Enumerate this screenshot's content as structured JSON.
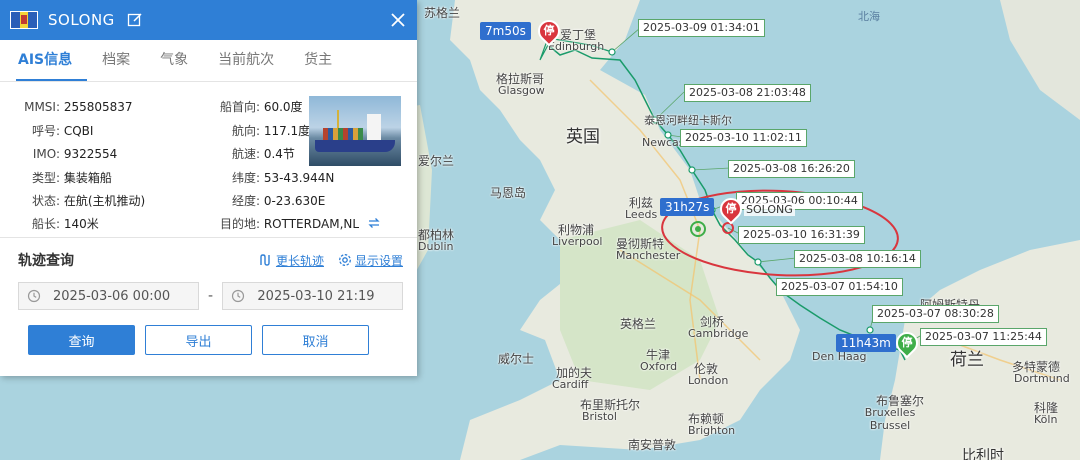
{
  "map": {
    "countries": {
      "uk": "英国",
      "nl": "荷兰",
      "be": "比利时"
    },
    "seas": {
      "north_sea": "北海"
    },
    "cities": [
      {
        "cn": "爱丁堡",
        "en": "Edinburgh"
      },
      {
        "cn": "格拉斯哥",
        "en": "Glasgow"
      },
      {
        "cn": "利兹",
        "en": "Leeds"
      },
      {
        "cn": "利物浦",
        "en": "Liverpool"
      },
      {
        "cn": "曼彻斯特",
        "en": "Manchester"
      },
      {
        "cn": "剑桥",
        "en": "Cambridge"
      },
      {
        "cn": "伦敦",
        "en": "London"
      },
      {
        "cn": "牛津",
        "en": "Oxford"
      },
      {
        "cn": "加的夫",
        "en": "Cardiff"
      },
      {
        "cn": "布里斯托尔",
        "en": "Bristol"
      },
      {
        "cn": "布赖顿",
        "en": "Brighton"
      },
      {
        "cn": "南安普敦",
        "en": "Southampton"
      },
      {
        "cn": "多特蒙德",
        "en": "Dortmund"
      },
      {
        "cn": "科隆",
        "en": "Köln"
      },
      {
        "cn": "布鲁塞尔",
        "en": "Bruxelles Brussel"
      },
      {
        "cn": "都柏林",
        "en": "Dublin"
      },
      {
        "cn": "阿姆斯特丹",
        "en": ""
      },
      {
        "cn": "泰恩河畔纽卡斯尔",
        "en": "Newcastle"
      },
      {
        "cn": "马恩岛",
        "en": ""
      },
      {
        "cn": "英格兰",
        "en": ""
      },
      {
        "cn": "威尔士",
        "en": ""
      },
      {
        "cn": "爱尔兰",
        "en": ""
      },
      {
        "cn": "苏格兰",
        "en": ""
      }
    ],
    "den_haag": "Den Haag",
    "timestamps": [
      "2025-03-09 01:34:01",
      "2025-03-08 21:03:48",
      "2025-03-10 11:02:11",
      "2025-03-08 16:26:20",
      "2025-03-06 00:10:44",
      "2025-03-10 16:31:39",
      "2025-03-08 10:16:14",
      "2025-03-07 01:54:10",
      "2025-03-07 08:30:28",
      "2025-03-07 11:25:44"
    ],
    "durations": [
      "7m50s",
      "31h27s",
      "11h43m"
    ],
    "stop_label": "停",
    "ship_name_label": "SOLONG",
    "colors": {
      "track": "#1a9b6a",
      "highlight_ring": "#d9363e",
      "land": "#e8eadf",
      "water": "#aad3df"
    }
  },
  "panel": {
    "ship_name": "SOLONG",
    "tabs": [
      "AIS信息",
      "档案",
      "气象",
      "当前航次",
      "货主"
    ],
    "active_tab": 0,
    "info_left": [
      {
        "label": "MMSI:",
        "value": "255805837"
      },
      {
        "label": "呼号:",
        "value": "CQBI"
      },
      {
        "label": "IMO:",
        "value": "9322554"
      },
      {
        "label": "类型:",
        "value": "集装箱船"
      },
      {
        "label": "状态:",
        "value": "在航(主机推动)"
      },
      {
        "label": "船长:",
        "value": "140米"
      }
    ],
    "info_right": [
      {
        "label": "船首向:",
        "value": "60.0度"
      },
      {
        "label": "航向:",
        "value": "117.1度"
      },
      {
        "label": "航速:",
        "value": "0.4节"
      },
      {
        "label": "纬度:",
        "value": "53-43.944N"
      },
      {
        "label": "经度:",
        "value": "0-23.630E"
      },
      {
        "label": "目的地:",
        "value": "ROTTERDAM,NL"
      }
    ],
    "track": {
      "title": "轨迹查询",
      "longer_link": "更长轨迹",
      "settings_link": "显示设置",
      "start": "2025-03-06 00:00",
      "end": "2025-03-10 21:19",
      "separator": "-",
      "buttons": {
        "query": "查询",
        "export": "导出",
        "cancel": "取消"
      }
    }
  }
}
